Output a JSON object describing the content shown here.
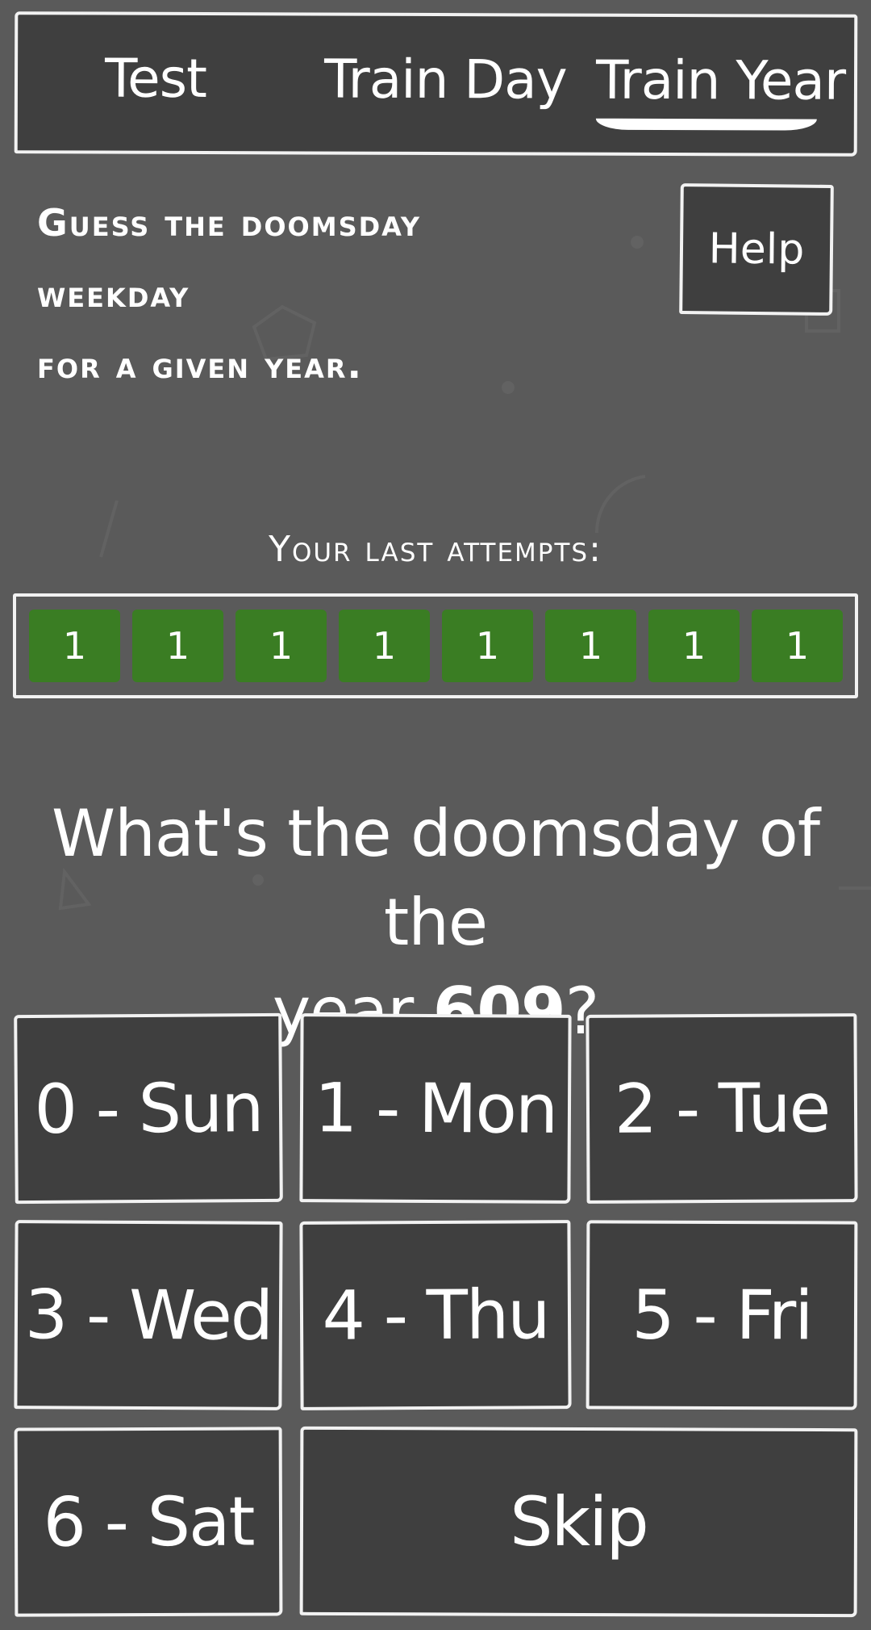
{
  "tabs": [
    {
      "label": "Test"
    },
    {
      "label": "Train Day"
    },
    {
      "label": "Train Year",
      "active": true
    }
  ],
  "instruction": {
    "lines": [
      "Guess the doomsday",
      "weekday",
      "for a given year."
    ]
  },
  "help_label": "Help",
  "attempts": {
    "label": "Your last attempts:",
    "items": [
      "1",
      "1",
      "1",
      "1",
      "1",
      "1",
      "1",
      "1"
    ],
    "color": "#3a7d23"
  },
  "question": {
    "prefix_line1": "What's the doomsday of the",
    "prefix_line2": "year ",
    "year": "609",
    "suffix": "?"
  },
  "answers": [
    {
      "label": "0 - Sun"
    },
    {
      "label": "1 - Mon"
    },
    {
      "label": "2 - Tue"
    },
    {
      "label": "3 - Wed"
    },
    {
      "label": "4 - Thu"
    },
    {
      "label": "5 - Fri"
    },
    {
      "label": "6 - Sat"
    }
  ],
  "skip_label": "Skip",
  "colors": {
    "background": "#5a5a5a",
    "panel": "#3f3f3f",
    "border": "#f2f2f2"
  }
}
